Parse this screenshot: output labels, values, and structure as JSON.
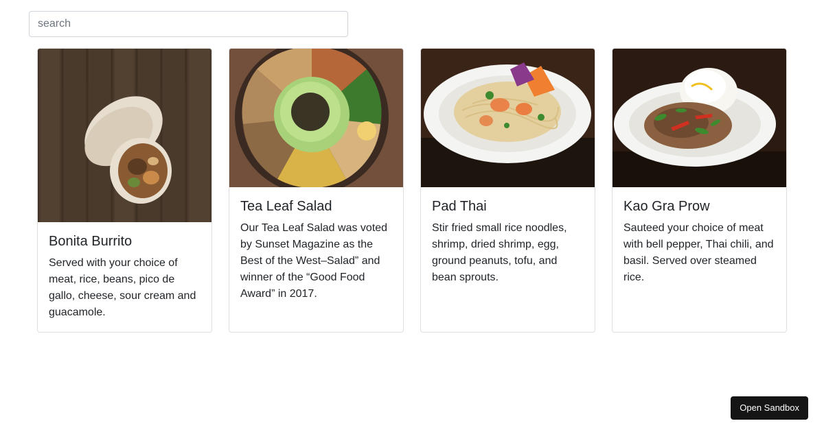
{
  "search": {
    "placeholder": "search",
    "value": ""
  },
  "cards": [
    {
      "title": "Bonita Burrito",
      "description": "Served with your choice of meat, rice, beans, pico de gallo, cheese, sour cream and guacamole.",
      "image": "burrito-photo"
    },
    {
      "title": "Tea Leaf Salad",
      "description": "Our Tea Leaf Salad was voted by Sunset Magazine as the Best of the West–Salad” and winner of the “Good Food Award” in 2017.",
      "image": "tea-leaf-salad-photo"
    },
    {
      "title": "Pad Thai",
      "description": "Stir fried small rice noodles, shrimp, dried shrimp, egg, ground peanuts, tofu, and bean sprouts.",
      "image": "pad-thai-photo"
    },
    {
      "title": "Kao Gra Prow",
      "description": "Sauteed your choice of meat with bell pepper, Thai chili, and basil. Served over steamed rice.",
      "image": "kao-gra-prow-photo"
    }
  ],
  "sandbox_button": {
    "label": "Open Sandbox"
  },
  "colors": {
    "button_bg": "#151515",
    "card_border": "#dfdfdf",
    "input_border": "#ced4da"
  }
}
